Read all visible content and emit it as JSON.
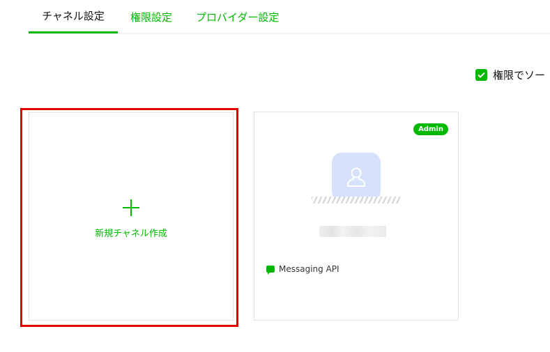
{
  "tabs": [
    {
      "label": "チャネル設定",
      "active": true
    },
    {
      "label": "権限設定",
      "active": false
    },
    {
      "label": "プロバイダー設定",
      "active": false
    }
  ],
  "sort": {
    "label": "権限でソー",
    "checked": true
  },
  "new_channel": {
    "label": "新規チャネル作成"
  },
  "channel": {
    "badge": "Admin",
    "type_label": "Messaging API"
  },
  "colors": {
    "accent": "#00b900",
    "highlight": "#e60000",
    "avatar_bg": "#d6e2fb"
  }
}
